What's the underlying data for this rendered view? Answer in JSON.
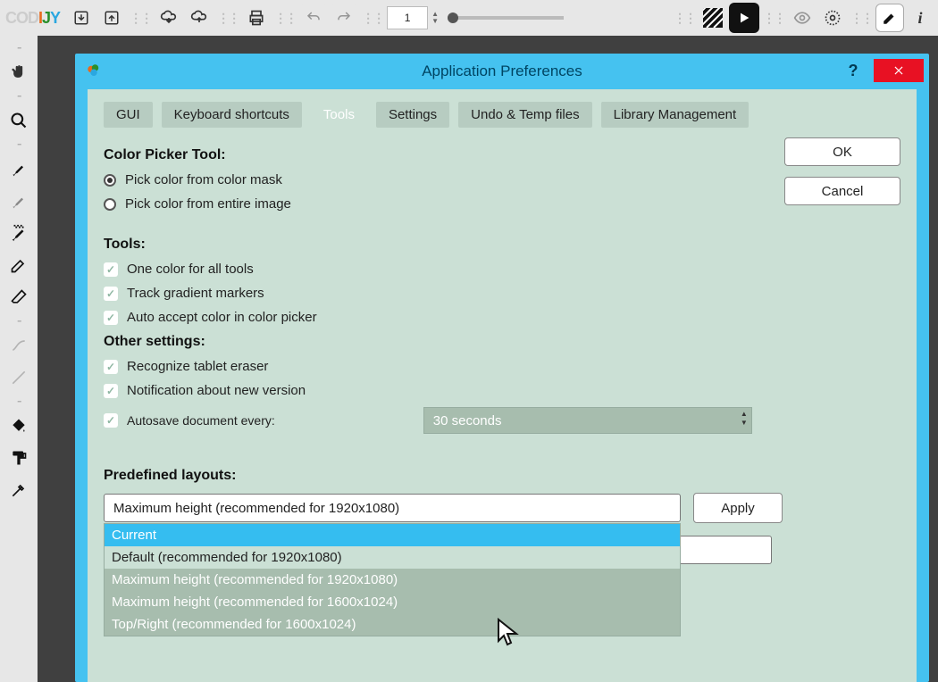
{
  "app_logo": "CODIJY",
  "toolbar": {
    "page_number": "1"
  },
  "dialog": {
    "title": "Application Preferences",
    "tabs": {
      "gui": "GUI",
      "keyboard": "Keyboard shortcuts",
      "tools": "Tools",
      "settings": "Settings",
      "undo": "Undo & Temp files",
      "library": "Library Management"
    },
    "ok": "OK",
    "cancel": "Cancel",
    "sections": {
      "color_picker_h": "Color Picker Tool:",
      "pick_mask": "Pick color from color mask",
      "pick_entire": "Pick color from entire image",
      "tools_h": "Tools:",
      "one_color": "One color for all tools",
      "track_grad": "Track gradient markers",
      "auto_accept": "Auto accept color in color picker",
      "other_h": "Other settings:",
      "recognize_tablet": "Recognize tablet eraser",
      "notify_version": "Notification about new version",
      "autosave_label": "Autosave document every:",
      "autosave_value": "30 seconds",
      "layouts_h": "Predefined layouts:",
      "layouts_value": "Maximum height (recommended for 1920x1080)",
      "apply": "Apply"
    },
    "dropdown": {
      "opt0": "Current",
      "opt1": "Default (recommended for 1920x1080)",
      "opt2": "Maximum height (recommended for 1920x1080)",
      "opt3": "Maximum height (recommended for 1600x1024)",
      "opt4": "Top/Right (recommended for 1600x1024)"
    }
  }
}
